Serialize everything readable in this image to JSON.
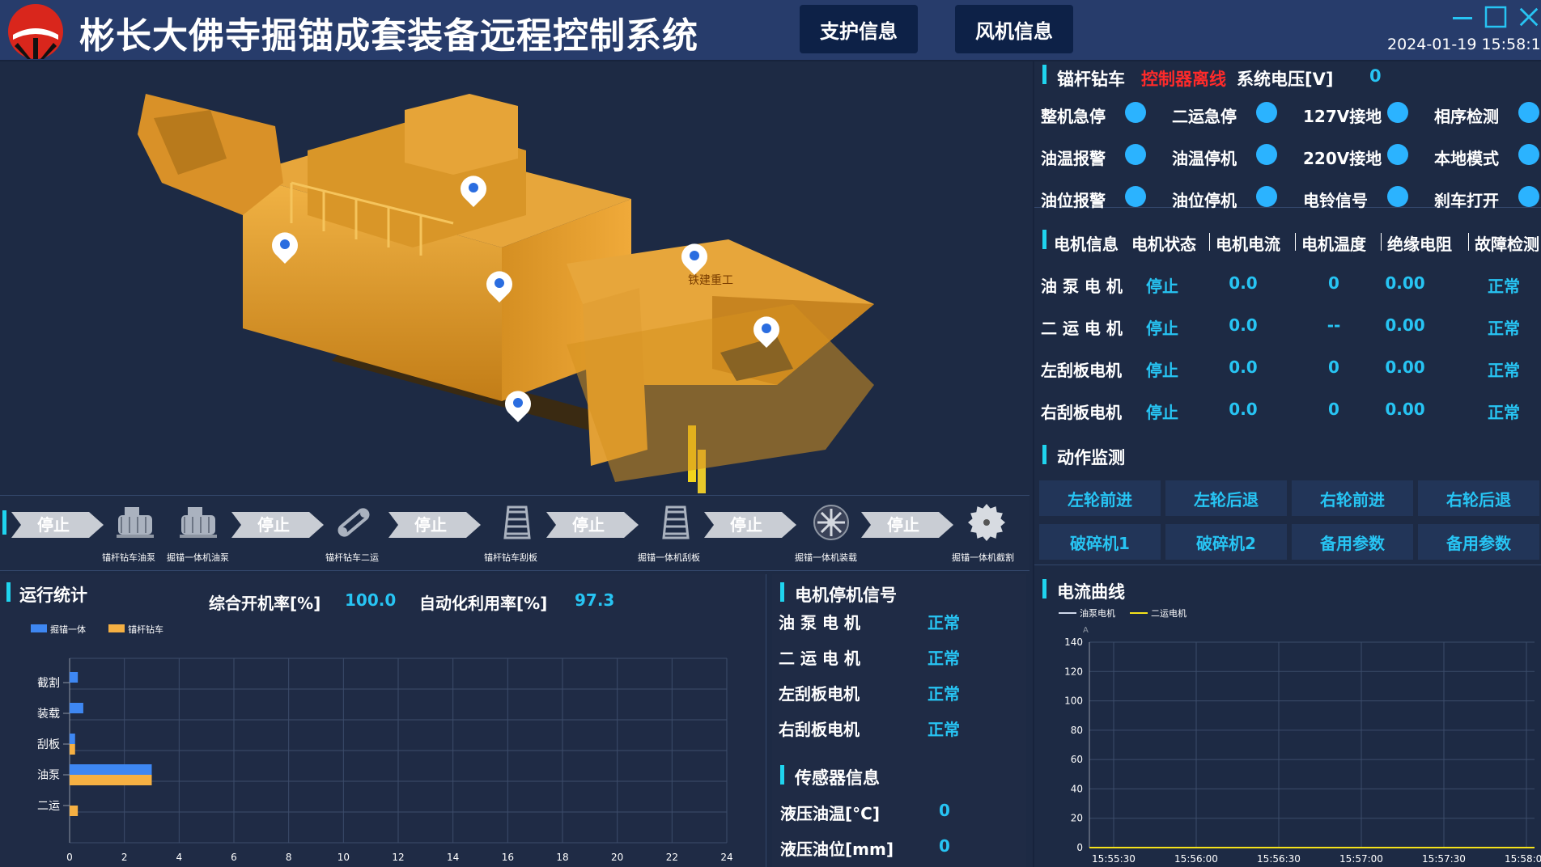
{
  "header": {
    "title": "彬长大佛寺掘锚成套装备远程控制系统",
    "nav_support": "支护信息",
    "nav_fan": "风机信息",
    "datetime": "2024-01-19  15:58:17"
  },
  "scene": {
    "markers": 6,
    "machine_brand": "铁建重工"
  },
  "strip": {
    "stop_label": "停止",
    "devices": [
      {
        "icon": "pump-icon",
        "label": "锚杆钻车油泵"
      },
      {
        "icon": "pump-icon",
        "label": "掘锚一体机油泵"
      },
      {
        "icon": "chain-icon",
        "label": "锚杆钻车二运"
      },
      {
        "icon": "scraper-icon",
        "label": "锚杆钻车刮板"
      },
      {
        "icon": "scraper-icon",
        "label": "掘锚一体机刮板"
      },
      {
        "icon": "fan-loader-icon",
        "label": "掘锚一体机装载"
      },
      {
        "icon": "saw-blade-icon",
        "label": "掘锚一体机截割"
      }
    ]
  },
  "stats": {
    "title": "运行统计",
    "overall_label": "综合开机率[%]",
    "overall_value": "100.0",
    "auto_label": "自动化利用率[%]",
    "auto_value": "97.3",
    "legend_a": "掘锚一体",
    "legend_b": "锚杆钻车",
    "colors": {
      "a": "#3e87f2",
      "b": "#f5b043"
    }
  },
  "chart_data": [
    {
      "type": "bar",
      "orientation": "horizontal",
      "categories": [
        "截割",
        "装载",
        "刮板",
        "油泵",
        "二运"
      ],
      "series": [
        {
          "name": "掘锚一体",
          "values": [
            0.3,
            0.5,
            0.2,
            3.0,
            0
          ]
        },
        {
          "name": "锚杆钻车",
          "values": [
            0,
            0,
            0.2,
            3.0,
            0.3
          ]
        }
      ],
      "xlim": [
        0,
        24
      ],
      "xticks": [
        0,
        2,
        4,
        6,
        8,
        10,
        12,
        14,
        16,
        18,
        20,
        22,
        24
      ],
      "grid": true,
      "legend_position": "top-left"
    },
    {
      "type": "line",
      "title": "电流曲线",
      "x": [
        "15:55:30",
        "15:56:00",
        "15:56:30",
        "15:57:00",
        "15:57:30",
        "15:58:00"
      ],
      "series": [
        {
          "name": "油泵电机",
          "values": [
            0,
            0,
            0,
            0,
            0,
            0
          ],
          "color": "#cfd8ea"
        },
        {
          "name": "二运电机",
          "values": [
            0,
            0,
            0,
            0,
            0,
            0
          ],
          "color": "#f5e21b"
        }
      ],
      "ylim": [
        0,
        140
      ],
      "yticks": [
        0,
        20,
        40,
        60,
        80,
        100,
        120,
        140
      ],
      "y_unit": "A",
      "grid": true,
      "legend_position": "top-left"
    }
  ],
  "stop_signals": {
    "title": "电机停机信号",
    "rows": [
      {
        "name": "油 泵 电 机",
        "status": "正常"
      },
      {
        "name": "二 运 电 机",
        "status": "正常"
      },
      {
        "name": "左刮板电机",
        "status": "正常"
      },
      {
        "name": "右刮板电机",
        "status": "正常"
      }
    ]
  },
  "sensors": {
    "title": "传感器信息",
    "rows": [
      {
        "name": "液压油温[°C]",
        "value": "0"
      },
      {
        "name": "液压油位[mm]",
        "value": "0"
      }
    ]
  },
  "right": {
    "section1": "锚杆钻车",
    "controller_status": "控制器离线",
    "voltage_label": "系统电压[V]",
    "voltage_value": "0",
    "indicators": [
      [
        "整机急停",
        "二运急停",
        "127V接地",
        "相序检测"
      ],
      [
        "油温报警",
        "油温停机",
        "220V接地",
        "本地模式"
      ],
      [
        "油位报警",
        "油位停机",
        "电铃信号",
        "刹车打开"
      ]
    ],
    "motor_header": [
      "电机信息",
      "电机状态",
      "电机电流",
      "电机温度",
      "绝缘电阻",
      "故障检测"
    ],
    "motors": [
      {
        "name": "油 泵 电 机",
        "state": "停止",
        "current": "0.0",
        "temp": "0",
        "insulation": "0.00",
        "fault": "正常"
      },
      {
        "name": "二 运 电 机",
        "state": "停止",
        "current": "0.0",
        "temp": "--",
        "insulation": "0.00",
        "fault": "正常"
      },
      {
        "name": "左刮板电机",
        "state": "停止",
        "current": "0.0",
        "temp": "0",
        "insulation": "0.00",
        "fault": "正常"
      },
      {
        "name": "右刮板电机",
        "state": "停止",
        "current": "0.0",
        "temp": "0",
        "insulation": "0.00",
        "fault": "正常"
      }
    ],
    "action_title": "动作监测",
    "actions": [
      "左轮前进",
      "左轮后退",
      "右轮前进",
      "右轮后退",
      "破碎机1",
      "破碎机2",
      "备用参数",
      "备用参数"
    ],
    "curve_title": "电流曲线"
  }
}
